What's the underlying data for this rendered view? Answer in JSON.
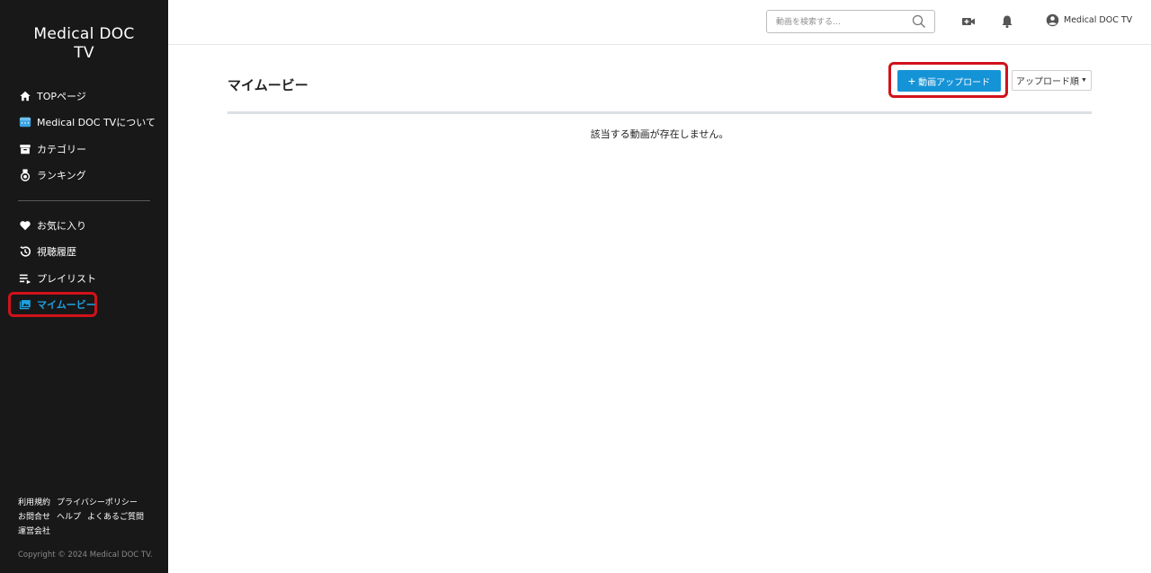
{
  "app": {
    "logo_line1": "Medical DOC",
    "logo_line2": "TV"
  },
  "sidebar": {
    "main_items": [
      {
        "label": "TOPページ",
        "icon": "home-icon"
      },
      {
        "label": "Medical DOC TVについて",
        "icon": "calendar-icon"
      },
      {
        "label": "カテゴリー",
        "icon": "archive-icon"
      },
      {
        "label": "ランキング",
        "icon": "medal-icon"
      }
    ],
    "sub_items": [
      {
        "label": "お気に入り",
        "icon": "heart-icon"
      },
      {
        "label": "視聴履歴",
        "icon": "history-icon"
      },
      {
        "label": "プレイリスト",
        "icon": "playlist-icon"
      },
      {
        "label": "マイムービー",
        "icon": "video-library-icon",
        "active": true
      }
    ],
    "footer_row1": [
      "利用規約",
      "プライバシーポリシー"
    ],
    "footer_row2": [
      "お問合せ",
      "ヘルプ",
      "よくあるご質問"
    ],
    "footer_row3": [
      "運営会社"
    ],
    "copyright": "Copyright © 2024 Medical DOC TV."
  },
  "header": {
    "search_placeholder": "動画を検索する…",
    "user_name": "Medical DOC TV"
  },
  "main": {
    "title": "マイムービー",
    "upload_label": "動画アップロード",
    "sort_label": "アップロード順",
    "empty_message": "該当する動画が存在しません。"
  },
  "colors": {
    "sidebar_bg": "#181818",
    "accent": "#1593d7",
    "highlight": "#d0121b"
  }
}
